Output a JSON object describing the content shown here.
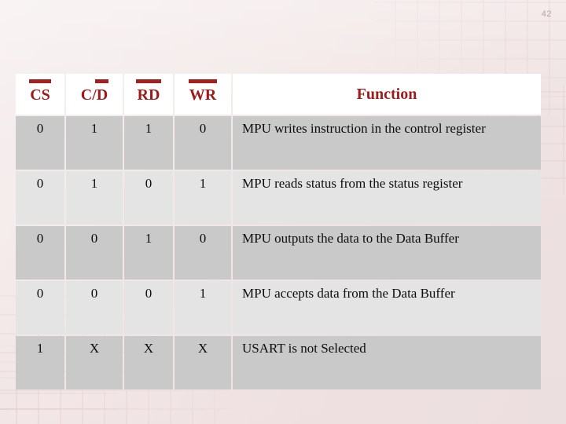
{
  "slide": {
    "page_number": "42",
    "accent_color": "#a32020",
    "header_text_color": "#9c1b1b",
    "background_color": "#f3e8e8",
    "row_color_odd": "#c9c9c9",
    "row_color_even": "#e4e4e4"
  },
  "table": {
    "headers": [
      {
        "label": "CS",
        "overline": "full",
        "name": "chip-select"
      },
      {
        "label": "C/D",
        "overline": "partial",
        "name": "control-data"
      },
      {
        "label": "RD",
        "overline": "full",
        "name": "read"
      },
      {
        "label": "WR",
        "overline": "full",
        "name": "write"
      },
      {
        "label": "Function",
        "overline": "none",
        "name": "function"
      }
    ],
    "rows": [
      {
        "cs": "0",
        "cd": "1",
        "rd": "1",
        "wr": "0",
        "function": "MPU writes instruction in the control register"
      },
      {
        "cs": "0",
        "cd": "1",
        "rd": "0",
        "wr": "1",
        "function": "MPU reads status from the status register"
      },
      {
        "cs": "0",
        "cd": "0",
        "rd": "1",
        "wr": "0",
        "function": "MPU outputs the data to the Data Buffer"
      },
      {
        "cs": "0",
        "cd": "0",
        "rd": "0",
        "wr": "1",
        "function": "MPU accepts data from the Data Buffer"
      },
      {
        "cs": "1",
        "cd": "X",
        "rd": "X",
        "wr": "X",
        "function": "USART is not Selected"
      }
    ]
  }
}
